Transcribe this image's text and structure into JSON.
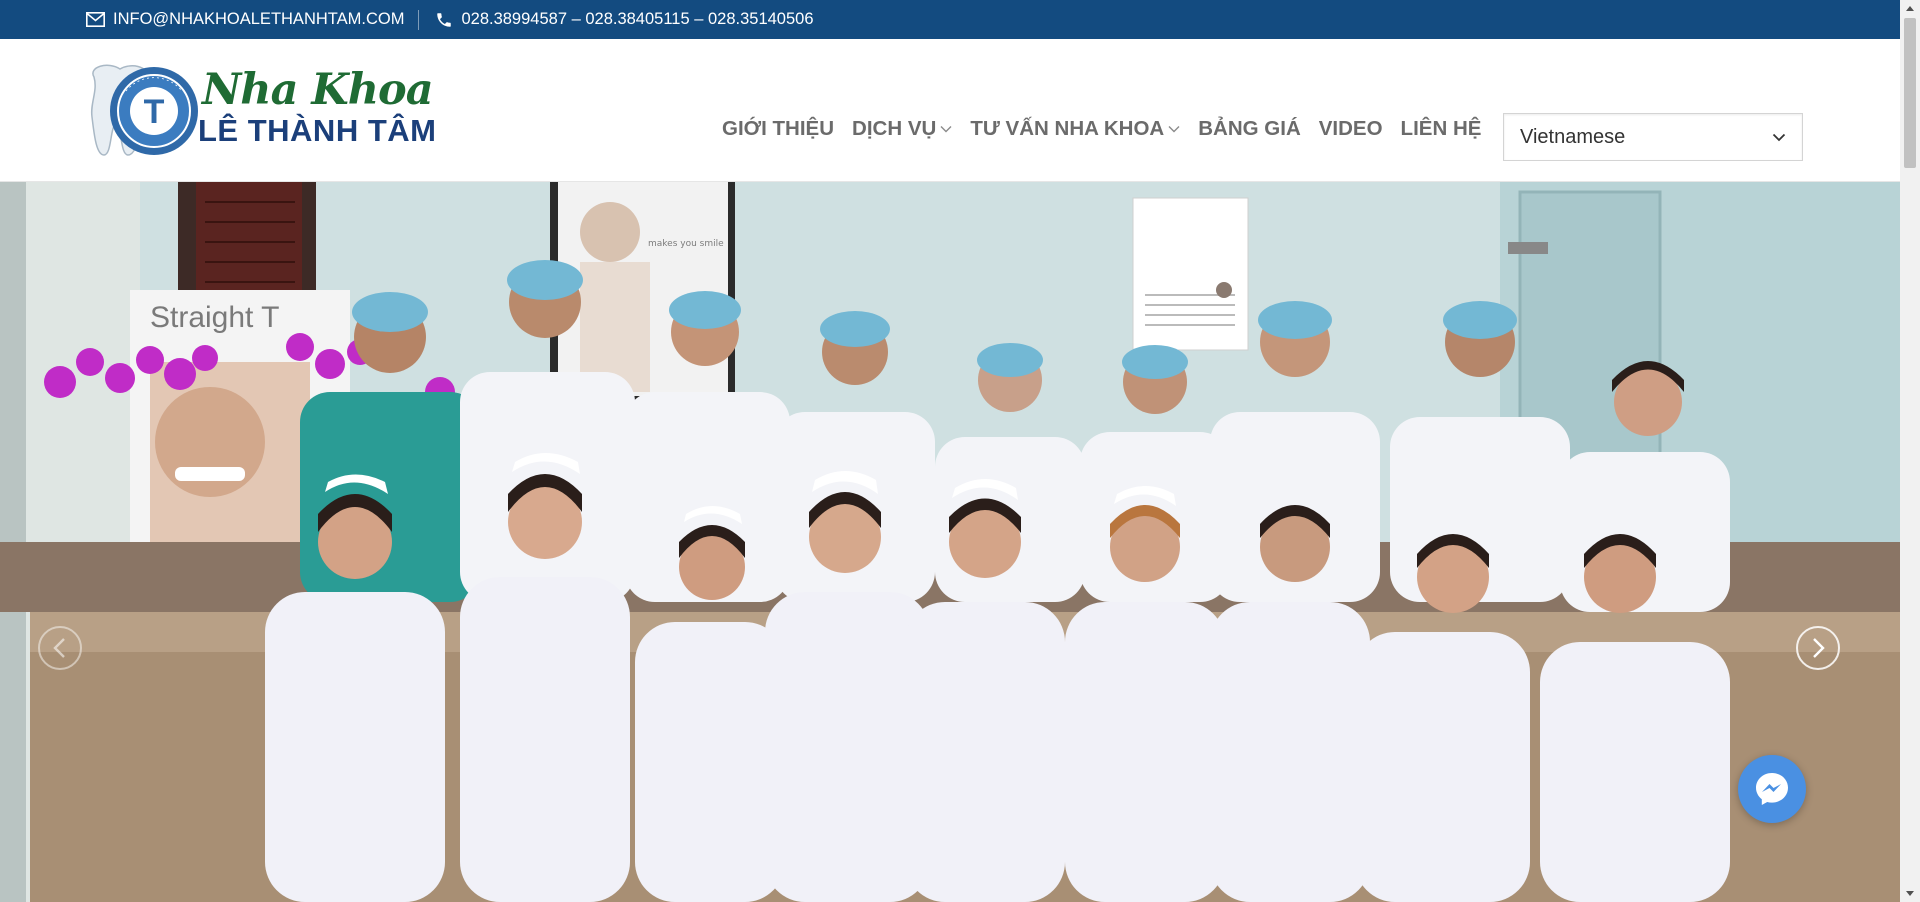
{
  "topbar": {
    "email": "INFO@NHAKHOALETHANHTAM.COM",
    "phones": "028.38994587 – 028.38405115 – 028.35140506"
  },
  "logo": {
    "script_text": "Nha Khoa",
    "name_text": "LÊ THÀNH TÂM",
    "badge_letter": "T",
    "badge_ring_text": "NHA KHOA · LÊ THÀNH TÂM"
  },
  "nav": {
    "items": [
      {
        "label": "GIỚI THIỆU",
        "has_dropdown": false
      },
      {
        "label": "DỊCH VỤ",
        "has_dropdown": true
      },
      {
        "label": "TƯ VẤN NHA KHOA",
        "has_dropdown": true
      },
      {
        "label": "BẢNG GIÁ",
        "has_dropdown": false
      },
      {
        "label": "VIDEO",
        "has_dropdown": false
      },
      {
        "label": "LIÊN HỆ",
        "has_dropdown": false
      }
    ]
  },
  "language": {
    "flags": [
      "armenian-flag",
      "chinese-flag",
      "us-flag",
      "french-flag",
      "german-flag",
      "italian-flag",
      "korean-flag",
      "russian-flag",
      "mexican-flag",
      "vietnamese-flag"
    ],
    "selected": "Vietnamese"
  },
  "hero": {
    "banner_text": "Straight T",
    "poster_text": "makes you smile"
  },
  "colors": {
    "topbar_bg": "#134b80",
    "nav_text": "#6b6b6b",
    "logo_green": "#1f6b34",
    "logo_blue": "#1b3f7a",
    "messenger": "#4a90e2"
  }
}
